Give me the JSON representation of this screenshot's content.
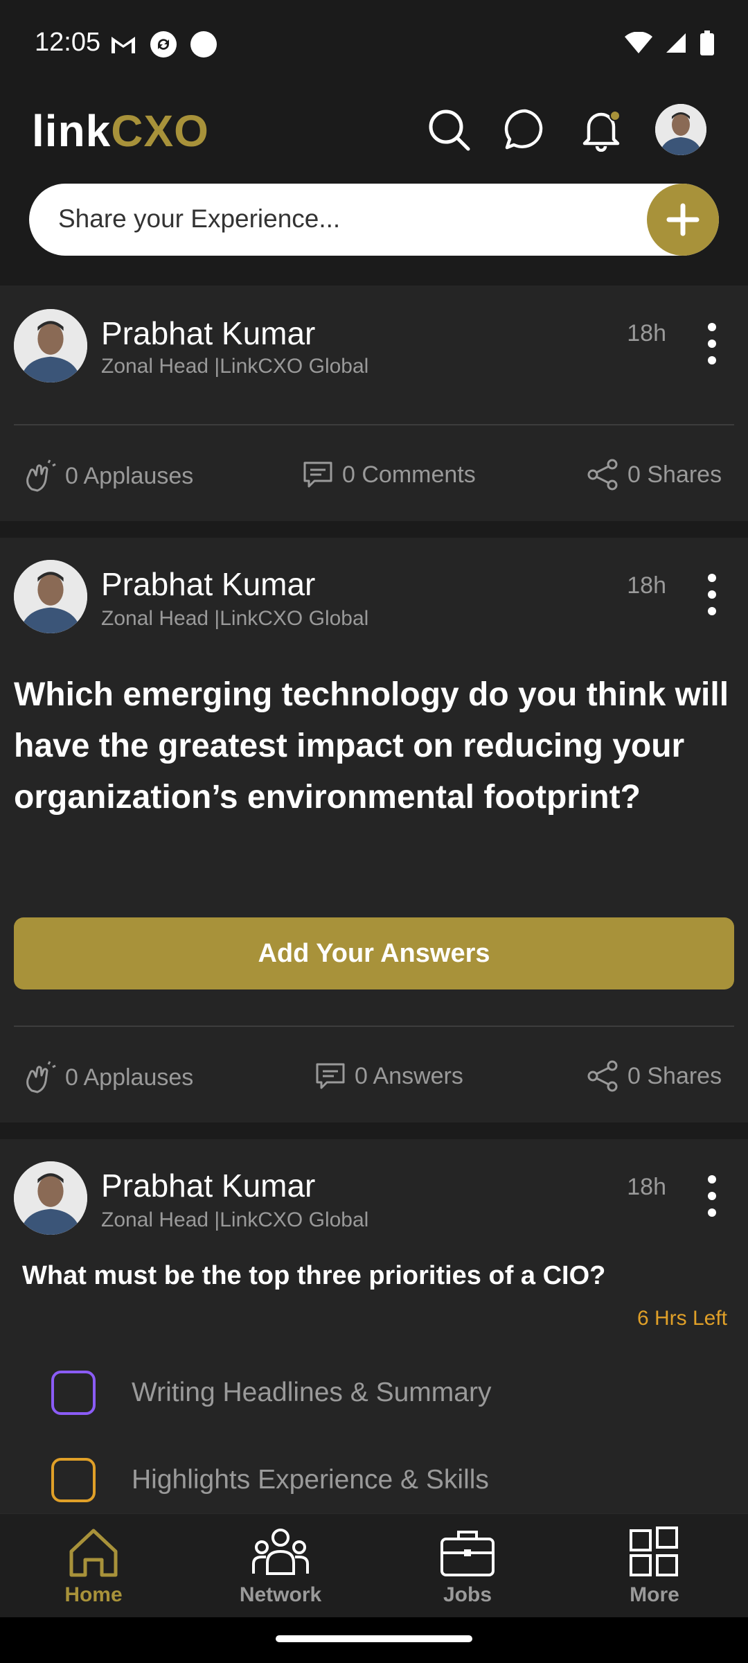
{
  "status_bar": {
    "time": "12:05"
  },
  "header": {
    "logo_link": "link",
    "logo_cxo": "CXO",
    "share_placeholder": "Share your Experience..."
  },
  "colors": {
    "accent": "#a8923a",
    "timer": "#e0a028",
    "option_purple": "#8b5cf6",
    "option_orange": "#e0a028"
  },
  "posts": [
    {
      "author": "Prabhat Kumar",
      "subtitle": "Zonal Head |LinkCXO Global",
      "time": "18h",
      "applauses": "0 Applauses",
      "comments": "0 Comments",
      "shares": "0 Shares"
    },
    {
      "author": "Prabhat Kumar",
      "subtitle": "Zonal Head |LinkCXO Global",
      "time": "18h",
      "question": "Which emerging technology do you think will have the greatest impact on reducing your organization’s environmental footprint?",
      "answer_button": "Add Your Answers",
      "applauses": "0 Applauses",
      "answers": "0 Answers",
      "shares": "0 Shares"
    },
    {
      "author": "Prabhat Kumar",
      "subtitle": "Zonal Head |LinkCXO Global",
      "time": "18h",
      "poll_question": "What must be the top three priorities of a CIO?",
      "time_left": "6 Hrs Left",
      "options": [
        "Writing Headlines & Summary",
        "Highlights Experience & Skills"
      ]
    }
  ],
  "bottom_nav": [
    {
      "label": "Home",
      "icon": "home-icon",
      "active": true
    },
    {
      "label": "Network",
      "icon": "network-icon",
      "active": false
    },
    {
      "label": "Jobs",
      "icon": "briefcase-icon",
      "active": false
    },
    {
      "label": "More",
      "icon": "grid-icon",
      "active": false
    }
  ]
}
